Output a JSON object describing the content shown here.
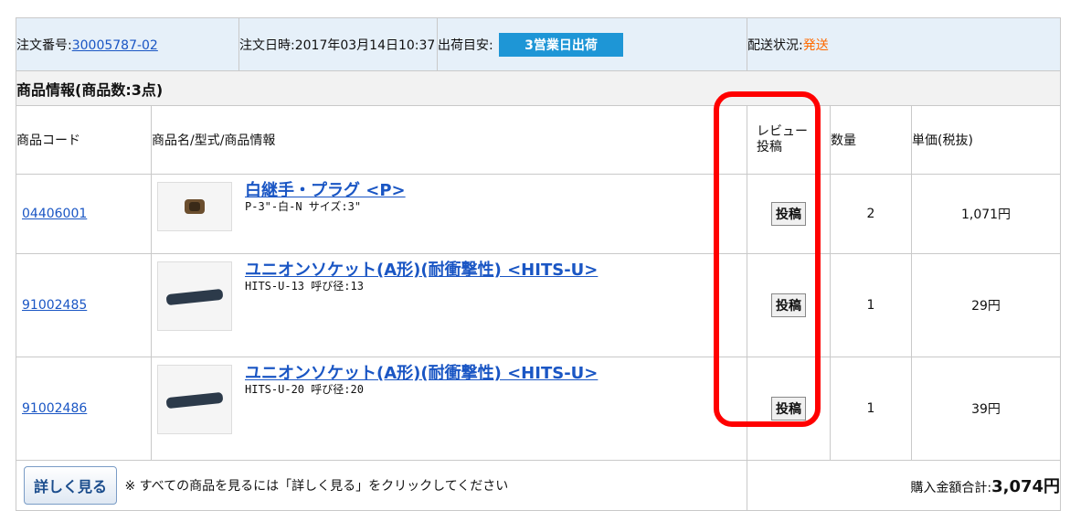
{
  "header": {
    "order_no_label": "注文番号:",
    "order_no": "30005787-02",
    "order_date": "注文日時:2017年03月14日10:37",
    "ship_label": "出荷目安:",
    "ship_badge": "3営業日出荷",
    "delivery_label": "配送状況:",
    "delivery_status": "発送"
  },
  "section_title": "商品情報(商品数:3点)",
  "columns": {
    "code": "商品コード",
    "name": "商品名/型式/商品情報",
    "review_line1": "レビュー",
    "review_line2": "投稿",
    "qty": "数量",
    "price": "単価(税抜)"
  },
  "items": [
    {
      "code": "04406001",
      "name": "白継手・プラグ <P>",
      "info": "P-3\"-白-N サイズ:3\"",
      "post": "投稿",
      "qty": "2",
      "price": "1,071円"
    },
    {
      "code": "91002485",
      "name": "ユニオンソケット(A形)(耐衝撃性) <HITS-U>",
      "info": "HITS-U-13 呼び径:13",
      "post": "投稿",
      "qty": "1",
      "price": "29円"
    },
    {
      "code": "91002486",
      "name": "ユニオンソケット(A形)(耐衝撃性) <HITS-U>",
      "info": "HITS-U-20 呼び径:20",
      "post": "投稿",
      "qty": "1",
      "price": "39円"
    }
  ],
  "footer": {
    "detail_button": "詳しく見る",
    "note": "※ すべての商品を見るには「詳しく見る」をクリックしてください",
    "total_label": "購入金額合計:",
    "total_value": "3,074円"
  },
  "colors": {
    "link": "#1a56c4",
    "badge": "#1e96d6",
    "status": "#ff6a00",
    "highlight": "#ff0000"
  }
}
